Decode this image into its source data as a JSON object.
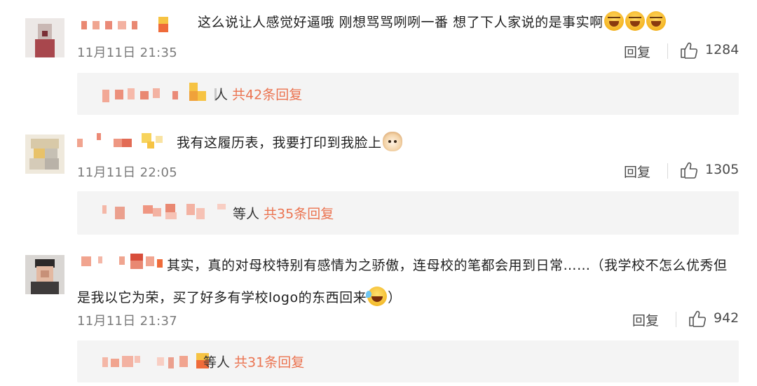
{
  "colors": {
    "link_orange": "#eb7350",
    "time_gray": "#7a7a7a",
    "reply_box_bg": "#f4f4f4"
  },
  "comments": [
    {
      "text_html_parts": [
        "这么说让人感觉好逼哦  刚想骂骂咧咧一番  想了下人家说的是事实啊"
      ],
      "emoji": [
        "crying-laugh-icon",
        "crying-laugh-icon",
        "crying-laugh-icon"
      ],
      "time": "11月11日 21:35",
      "reply_label": "回复",
      "likes": "1284",
      "reply_summary": {
        "people": "人",
        "count_label": "共42条回复"
      }
    },
    {
      "text_html_parts": [
        "我有这履历表，我要打印到我脸上"
      ],
      "emoji": [
        "cat-face-icon"
      ],
      "time": "11月11日 22:05",
      "reply_label": "回复",
      "likes": "1305",
      "reply_summary": {
        "people": "等人",
        "count_label": "共35条回复"
      }
    },
    {
      "text_html_parts": [
        "其实，真的对母校特别有感情为之骄傲，连母校的笔都会用到日常……（我学校不怎么优秀但是我以它为荣，买了好多有学校logo的东西回来",
        "）"
      ],
      "emoji": [
        "laughing-tears-icon"
      ],
      "time": "11月11日 21:37",
      "reply_label": "回复",
      "likes": "942",
      "reply_summary": {
        "people": "等人",
        "count_label": "共31条回复"
      }
    }
  ]
}
